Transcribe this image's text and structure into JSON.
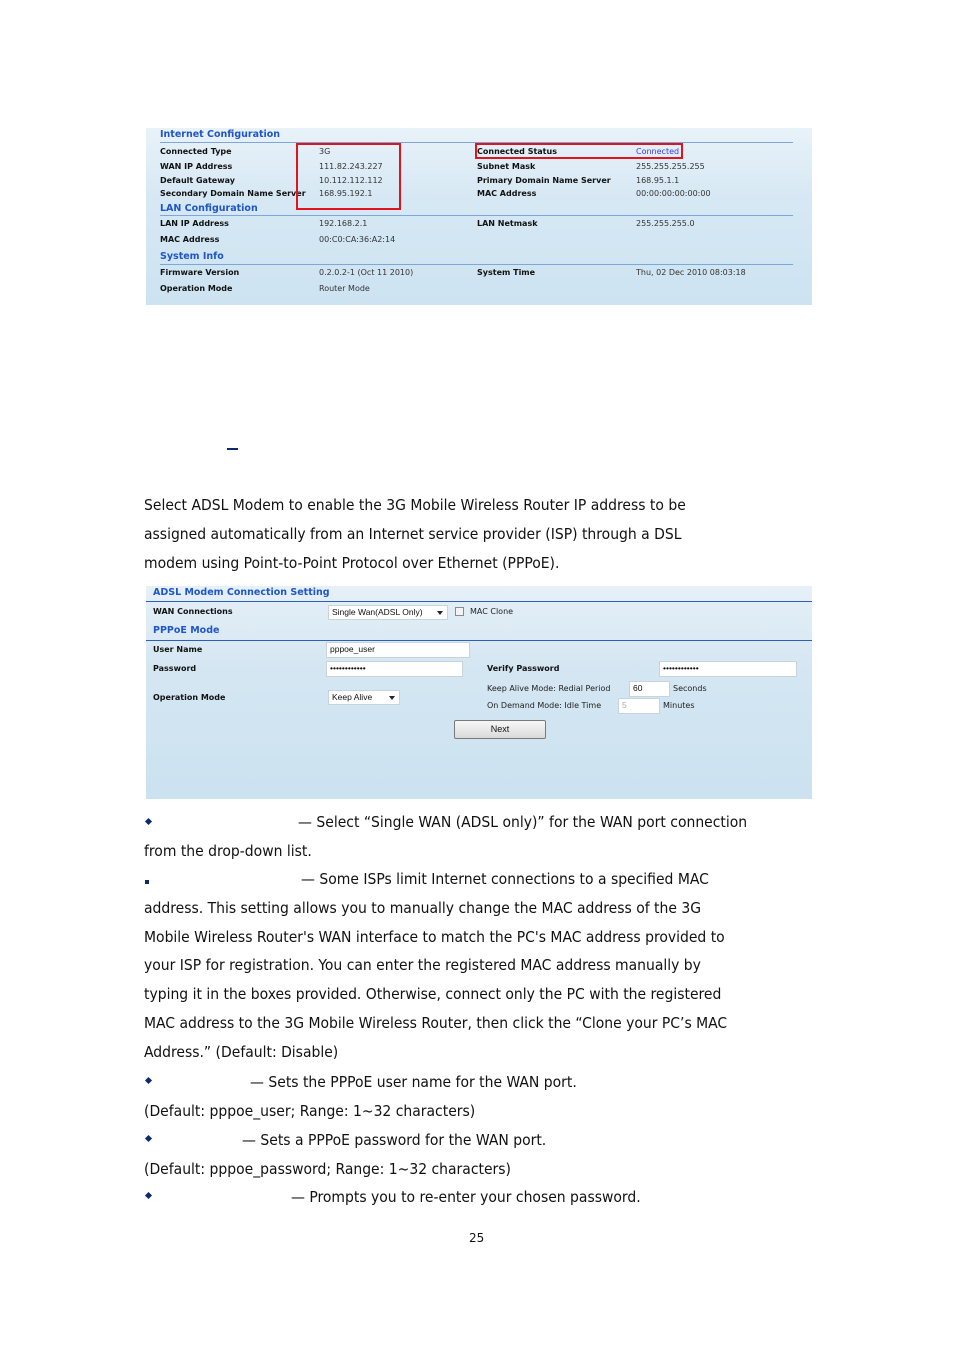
{
  "status_panel": {
    "internet": {
      "title": "Internet Configuration",
      "left": [
        {
          "label": "Connected Type",
          "value": "3G"
        },
        {
          "label": "WAN IP Address",
          "value": "111.82.243.227"
        },
        {
          "label": "Default Gateway",
          "value": "10.112.112.112"
        },
        {
          "label": "Secondary Domain Name Server",
          "value": "168.95.192.1"
        }
      ],
      "right": [
        {
          "label": "Connected Status",
          "value": "Connected"
        },
        {
          "label": "Subnet Mask",
          "value": "255.255.255.255"
        },
        {
          "label": "Primary Domain Name Server",
          "value": "168.95.1.1"
        },
        {
          "label": "MAC Address",
          "value": "00:00:00:00:00:00"
        }
      ]
    },
    "lan": {
      "title": "LAN Configuration",
      "left": [
        {
          "label": "LAN IP Address",
          "value": "192.168.2.1"
        },
        {
          "label": "MAC Address",
          "value": "00:C0:CA:36:A2:14"
        }
      ],
      "right": [
        {
          "label": "LAN Netmask",
          "value": "255.255.255.0"
        }
      ]
    },
    "system": {
      "title": "System Info",
      "left": [
        {
          "label": "Firmware Version",
          "value": "0.2.0.2-1 (Oct 11 2010)"
        },
        {
          "label": "Operation Mode",
          "value": "Router Mode"
        }
      ],
      "right": [
        {
          "label": "System Time",
          "value": "Thu, 02 Dec 2010 08:03:18"
        }
      ]
    },
    "highlight_color": "#e0141c"
  },
  "intro": {
    "lines": [
      "Select ADSL Modem to enable the 3G Mobile Wireless Router IP address to be",
      "assigned automatically from an Internet service provider (ISP) through a DSL",
      "modem using Point-to-Point Protocol over Ethernet (PPPoE)."
    ]
  },
  "adsl_form": {
    "title": "ADSL Modem Connection Setting",
    "wan_connections_label": "WAN Connections",
    "wan_connections_value": "Single Wan(ADSL Only)",
    "mac_clone_label": "MAC Clone",
    "mac_clone_checked": false,
    "pppoe_title": "PPPoE Mode",
    "user_name_label": "User Name",
    "user_name_value": "pppoe_user",
    "password_label": "Password",
    "password_value": "••••••••••••",
    "verify_password_label": "Verify Password",
    "verify_password_value": "••••••••••••",
    "operation_mode_label": "Operation Mode",
    "operation_mode_value": "Keep Alive",
    "keep_alive_label": "Keep Alive Mode: Redial Period",
    "keep_alive_value": "60",
    "keep_alive_unit": "Seconds",
    "on_demand_label": "On Demand Mode: Idle Time",
    "on_demand_value": "5",
    "on_demand_unit": "Minutes",
    "next_button": "Next"
  },
  "descriptions": {
    "wan_line1": "— Select “Single WAN (ADSL only)” for the WAN port connection",
    "wan_line2": "from the drop-down list.",
    "mac_lines": [
      "— Some ISPs limit Internet connections to a specified MAC",
      "address. This setting allows you to manually change the MAC address of the 3G",
      "Mobile Wireless Router's WAN interface to match the PC's MAC address provided to",
      "your ISP for registration. You can enter the registered MAC address manually by",
      "typing it in the boxes provided. Otherwise, connect only the PC with the registered",
      "MAC address to the 3G Mobile Wireless Router, then click the “Clone your PC’s MAC",
      "Address.” (Default: Disable)"
    ],
    "user_line1": "— Sets the PPPoE user name for the WAN port.",
    "user_line2": "(Default: pppoe_user; Range: 1~32 characters)",
    "pass_line1": "— Sets a PPPoE password for the WAN port.",
    "pass_line2": "(Default: pppoe_password; Range: 1~32 characters)",
    "verify_line1": "— Prompts you to re-enter your chosen password."
  },
  "page_number": "25"
}
